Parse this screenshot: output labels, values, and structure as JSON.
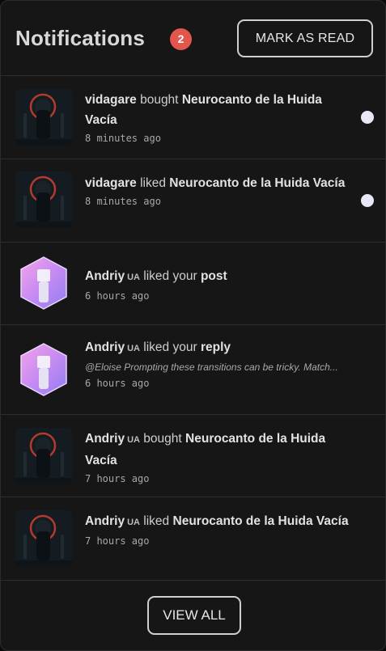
{
  "header": {
    "title": "Notifications",
    "unread_count": "2",
    "mark_read_label": "MARK AS READ"
  },
  "notifications": [
    {
      "user": "vidagare",
      "action": "bought",
      "target": "Neurocanto de la Huida Vacía",
      "time": "8 minutes ago",
      "thumbnail": "album-art",
      "unread": true
    },
    {
      "user": "vidagare",
      "action": "liked",
      "target": "Neurocanto de la Huida Vacía",
      "time": "8 minutes ago",
      "thumbnail": "album-art",
      "unread": true
    },
    {
      "user": "Andriy",
      "user_tag": "UA",
      "action": "liked your",
      "target": "post",
      "time": "6 hours ago",
      "thumbnail": "hexagon-avatar",
      "unread": false
    },
    {
      "user": "Andriy",
      "user_tag": "UA",
      "action": "liked your",
      "target": "reply",
      "excerpt": "@Eloise Prompting these transitions can be tricky. Match...",
      "time": "6 hours ago",
      "thumbnail": "hexagon-avatar",
      "unread": false
    },
    {
      "user": "Andriy",
      "user_tag": "UA",
      "action": "bought",
      "target": "Neurocanto de la Huida Vacía",
      "time": "7 hours ago",
      "thumbnail": "album-art",
      "unread": false
    },
    {
      "user": "Andriy",
      "user_tag": "UA",
      "action": "liked",
      "target": "Neurocanto de la Huida Vacía",
      "time": "7 hours ago",
      "thumbnail": "album-art",
      "unread": false
    }
  ],
  "footer": {
    "view_all_label": "VIEW ALL"
  },
  "colors": {
    "badge": "#e2564d",
    "panel_bg": "#161616",
    "unread_dot": "#e7e7f5"
  }
}
